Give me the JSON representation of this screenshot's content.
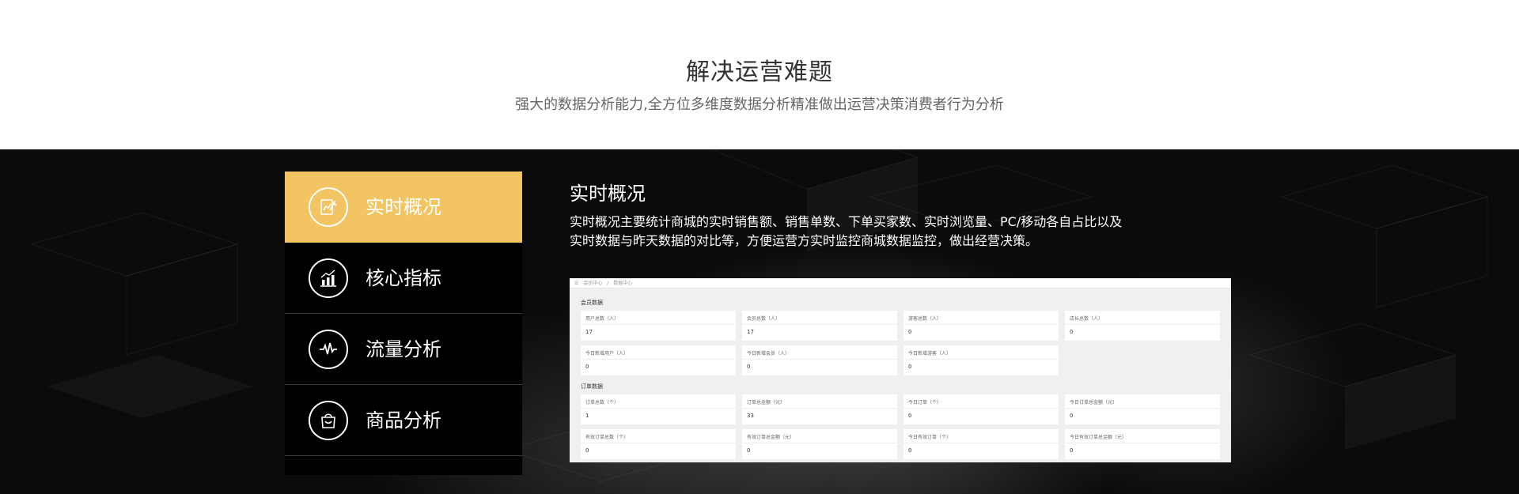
{
  "header": {
    "title": "解决运营难题",
    "subtitle": "强大的数据分析能力,全方位多维度数据分析精准做出运营决策消费者行为分析"
  },
  "menu": {
    "items": [
      {
        "label": "实时概况",
        "icon": "chart-pen-icon",
        "active": true
      },
      {
        "label": "核心指标",
        "icon": "bar-chart-icon",
        "active": false
      },
      {
        "label": "流量分析",
        "icon": "pulse-icon",
        "active": false
      },
      {
        "label": "商品分析",
        "icon": "shopping-bag-icon",
        "active": false
      }
    ]
  },
  "detail": {
    "title": "实时概况",
    "description": "实时概况主要统计商城的实时销售额、销售单数、下单买家数、实时浏览量、PC/移动各自占比以及实时数据与昨天数据的对比等，方便运营方实时监控商城数据监控，做出经营决策。"
  },
  "screenshot": {
    "breadcrumb": [
      "会员中心",
      "/",
      "数据中心"
    ],
    "member_section": "会员数据",
    "member_cards": [
      {
        "label": "用户总数（人）",
        "value": "17"
      },
      {
        "label": "会员总数（人）",
        "value": "17"
      },
      {
        "label": "游客总数（人）",
        "value": "0"
      },
      {
        "label": "店长总数（人）",
        "value": "0"
      },
      {
        "label": "今日新增用户（人）",
        "value": "0"
      },
      {
        "label": "今日新增会员（人）",
        "value": "0"
      },
      {
        "label": "今日新增游客（人）",
        "value": "0"
      }
    ],
    "order_section": "订单数据",
    "order_cards": [
      {
        "label": "订单总数（个）",
        "value": "1"
      },
      {
        "label": "订单总金额（元）",
        "value": "33"
      },
      {
        "label": "今日订单（个）",
        "value": "0"
      },
      {
        "label": "今日订单总金额（元）",
        "value": "0"
      },
      {
        "label": "有效订单总数（个）",
        "value": "0"
      },
      {
        "label": "有效订单总金额（元）",
        "value": "0"
      },
      {
        "label": "今日有效订单（个）",
        "value": "0"
      },
      {
        "label": "今日有效订单总金额（元）",
        "value": "0"
      }
    ]
  },
  "colors": {
    "accent": "#f2c462",
    "band": "#0b0b0b",
    "menu": "#000000"
  }
}
